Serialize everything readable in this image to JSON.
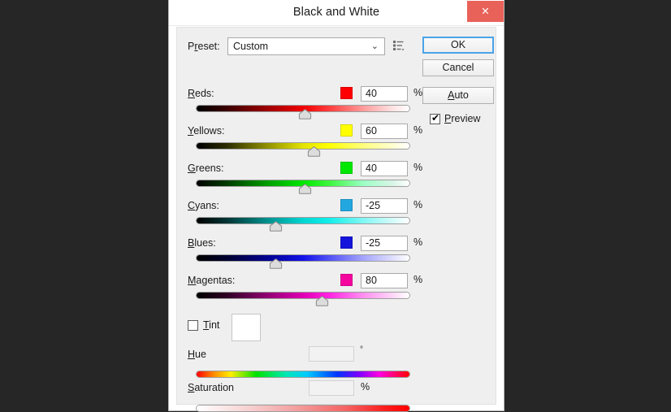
{
  "window": {
    "title": "Black and White",
    "close_label": "✕"
  },
  "preset": {
    "label": "P",
    "label_underlined": "r",
    "label_rest": "eset:",
    "label_full": "Preset:",
    "value": "Custom",
    "arrow": "⌄",
    "menu_icon": "preset-menu-icon"
  },
  "buttons": {
    "ok": "OK",
    "cancel": "Cancel",
    "auto": "Auto"
  },
  "preview": {
    "label": "Preview",
    "checked": true,
    "tick": "✔"
  },
  "tint": {
    "label": "Tint",
    "checked": false,
    "swatch_color": "#ffffff"
  },
  "sliders": [
    {
      "name": "reds",
      "label": "Reds:",
      "value": "40",
      "unit": "%",
      "swatch": "#ff0000",
      "thumb_pct": 50.8,
      "gradient": "linear-gradient(to right, #000000 0%, #3a0000 14%, #9c0000 33%, #f10000 50%, #ff3b3b 62%, #ff9a9a 78%, #ffe2e2 92%, #ffffff 100%)"
    },
    {
      "name": "yellows",
      "label": "Yellows:",
      "value": "60",
      "unit": "%",
      "swatch": "#ffff00",
      "thumb_pct": 54.9,
      "gradient": "linear-gradient(to right, #000000 0%, #2b2b00 14%, #8f8f00 33%, #e3e300 50%, #ffff00 62%, #ffff7d 78%, #ffffd0 92%, #ffffff 100%)"
    },
    {
      "name": "greens",
      "label": "Greens:",
      "value": "40",
      "unit": "%",
      "swatch": "#00e800",
      "thumb_pct": 50.8,
      "gradient": "linear-gradient(to right, #000000 0%, #003a00 14%, #009c00 33%, #00e800 50%, #3bf53b 62%, #9affc4 78%, #d8f5e6 92%, #ffffff 100%)"
    },
    {
      "name": "cyans",
      "label": "Cyans:",
      "value": "-25",
      "unit": "%",
      "swatch": "#22a7e0",
      "thumb_pct": 37.1,
      "gradient": "linear-gradient(to right, #000000 0%, #003433 14%, #008f8c 33%, #00d6d2 50%, #11eeea 62%, #7ff7f4 78%, #d4fbfa 92%, #ffffff 100%)"
    },
    {
      "name": "blues",
      "label": "Blues:",
      "value": "-25",
      "unit": "%",
      "swatch": "#1414dc",
      "thumb_pct": 37.1,
      "gradient": "linear-gradient(to right, #000000 0%, #00002e 14%, #000090 33%, #1212e8 50%, #4f4ff4 62%, #a3a3fb 78%, #dedeff 92%, #ffffff 100%)"
    },
    {
      "name": "magentas",
      "label": "Magentas:",
      "value": "80",
      "unit": "%",
      "swatch": "#f5059e",
      "thumb_pct": 58.7,
      "gradient": "linear-gradient(to right, #000000 0%, #2d0024 14%, #8f0070 33%, #e000b4 50%, #ff22e2 62%, #ff8ef0 78%, #ffd6f7 92%, #ffffff 100%)"
    }
  ],
  "hue": {
    "label": "Hue",
    "value": "",
    "unit": "°",
    "gradient": "linear-gradient(to right, #fe0000 0%, #ff8a00 8%, #ffee00 16%, #00e100 28%, #00e7b4 42%, #00c9ff 52%, #0036ff 66%, #7a00ff 76%, #ff00e1 86%, #ff0000 100%)"
  },
  "saturation": {
    "label": "Saturation",
    "value": "",
    "unit": "%",
    "gradient": "linear-gradient(to right, #ffffff 0%, #f7d6d6 22%, #f3a3a3 45%, #f46464 70%, #fa1f1f 88%, #ff0000 100%)"
  }
}
